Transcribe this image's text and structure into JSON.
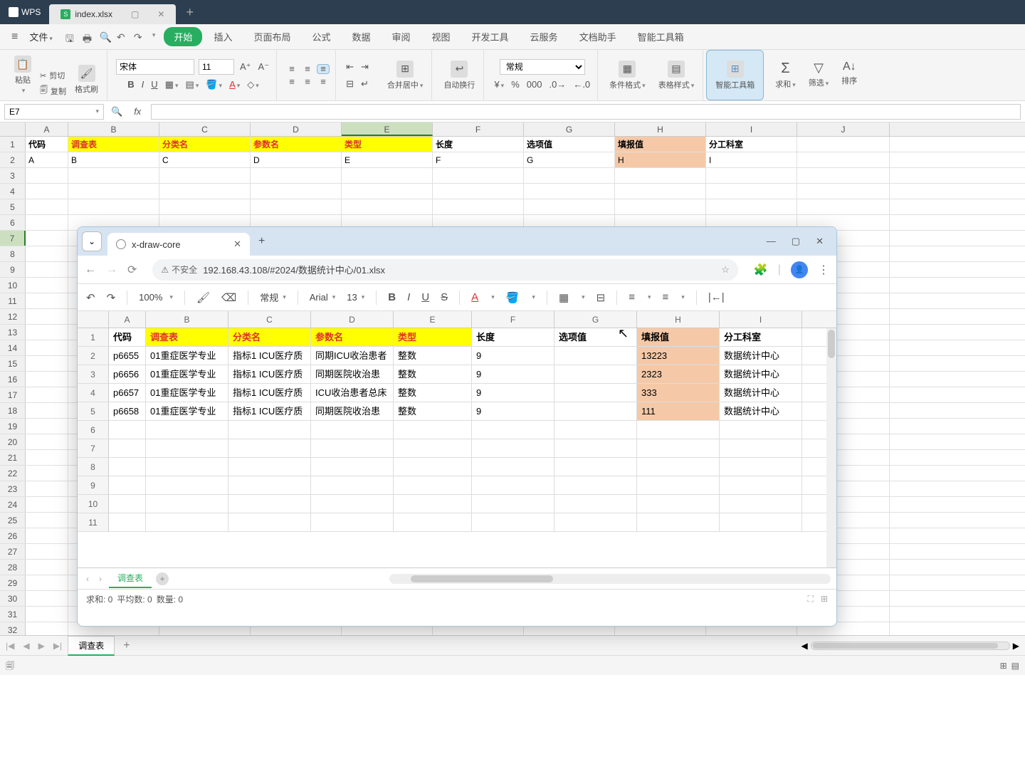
{
  "wps": {
    "logo": "WPS",
    "tab_name": "index.xlsx",
    "menu_file": "文件",
    "menu_items": [
      "开始",
      "插入",
      "页面布局",
      "公式",
      "数据",
      "审阅",
      "视图",
      "开发工具",
      "云服务",
      "文档助手",
      "智能工具箱"
    ],
    "ribbon": {
      "paste": "粘贴",
      "cut": "剪切",
      "copy": "复制",
      "format_painter": "格式刷",
      "font": "宋体",
      "font_size": "11",
      "merge_center": "合并居中",
      "auto_wrap": "自动换行",
      "number_format": "常规",
      "cond_format": "条件格式",
      "table_styles": "表格样式",
      "smart_tools": "智能工具箱",
      "sum": "求和",
      "filter": "筛选",
      "sort": "排序"
    },
    "namebox": "E7",
    "col_widths": {
      "A": 60,
      "B": 128,
      "C": 128,
      "D": 128,
      "E": 128,
      "F": 128,
      "G": 128,
      "H": 128,
      "I": 128,
      "J": 130
    },
    "columns": [
      "A",
      "B",
      "C",
      "D",
      "E",
      "F",
      "G",
      "H",
      "I",
      "J"
    ],
    "selected_col": "E",
    "selected_row": "7",
    "header_row": {
      "A": "代码",
      "B": "调查表",
      "C": "分类名",
      "D": "参数名",
      "E": "类型",
      "F": "长度",
      "G": "选项值",
      "H": "填报值",
      "I": "分工科室"
    },
    "header_style": {
      "A": "black",
      "B": "yellow",
      "C": "yellow",
      "D": "yellow",
      "E": "yellow",
      "F": "black",
      "G": "black",
      "H": "peach-black",
      "I": "black"
    },
    "row2": {
      "A": "A",
      "B": "B",
      "C": "C",
      "D": "D",
      "E": "E",
      "F": "F",
      "G": "G",
      "H": "H",
      "I": "I"
    },
    "row2_peach": "H",
    "sheet_tab": "调查表"
  },
  "browser": {
    "tab_title": "x-draw-core",
    "addr_warn": "不安全",
    "url": "192.168.43.108/#2024/数据统计中心/01.xlsx",
    "toolbar": {
      "zoom": "100%",
      "number_fmt": "常规",
      "font": "Arial",
      "font_size": "13"
    },
    "col_widths": {
      "A": 52,
      "B": 116,
      "C": 116,
      "D": 116,
      "E": 110,
      "F": 116,
      "G": 116,
      "H": 116,
      "I": 116
    },
    "columns": [
      "A",
      "B",
      "C",
      "D",
      "E",
      "F",
      "G",
      "H",
      "I"
    ],
    "header_row": {
      "A": "代码",
      "B": "调查表",
      "C": "分类名",
      "D": "参数名",
      "E": "类型",
      "F": "长度",
      "G": "选项值",
      "H": "填报值",
      "I": "分工科室"
    },
    "header_style": {
      "A": "black",
      "B": "yellow",
      "C": "yellow",
      "D": "yellow",
      "E": "yellow",
      "F": "black",
      "G": "black",
      "H": "peach-black",
      "I": "black"
    },
    "rows": [
      {
        "n": "2",
        "A": "p6655",
        "B": "01重症医学专业",
        "C": "指标1 ICU医疗质",
        "D": "同期ICU收治患者",
        "E": "整数",
        "F": "9",
        "G": "",
        "H": "13223",
        "I": "数据统计中心"
      },
      {
        "n": "3",
        "A": "p6656",
        "B": "01重症医学专业",
        "C": "指标1 ICU医疗质",
        "D": "同期医院收治患",
        "E": "整数",
        "F": "9",
        "G": "",
        "H": "2323",
        "I": "数据统计中心"
      },
      {
        "n": "4",
        "A": "p6657",
        "B": "01重症医学专业",
        "C": "指标1 ICU医疗质",
        "D": "ICU收治患者总床",
        "E": "整数",
        "F": "9",
        "G": "",
        "H": "333",
        "I": "数据统计中心"
      },
      {
        "n": "5",
        "A": "p6658",
        "B": "01重症医学专业",
        "C": "指标1 ICU医疗质",
        "D": "同期医院收治患",
        "E": "整数",
        "F": "9",
        "G": "",
        "H": "111",
        "I": "数据统计中心"
      }
    ],
    "empty_rows": [
      "6",
      "7",
      "8",
      "9",
      "10",
      "11"
    ],
    "sheet_tab": "调查表",
    "status": {
      "sum": "求和: 0",
      "avg": "平均数: 0",
      "count": "数量: 0"
    }
  }
}
